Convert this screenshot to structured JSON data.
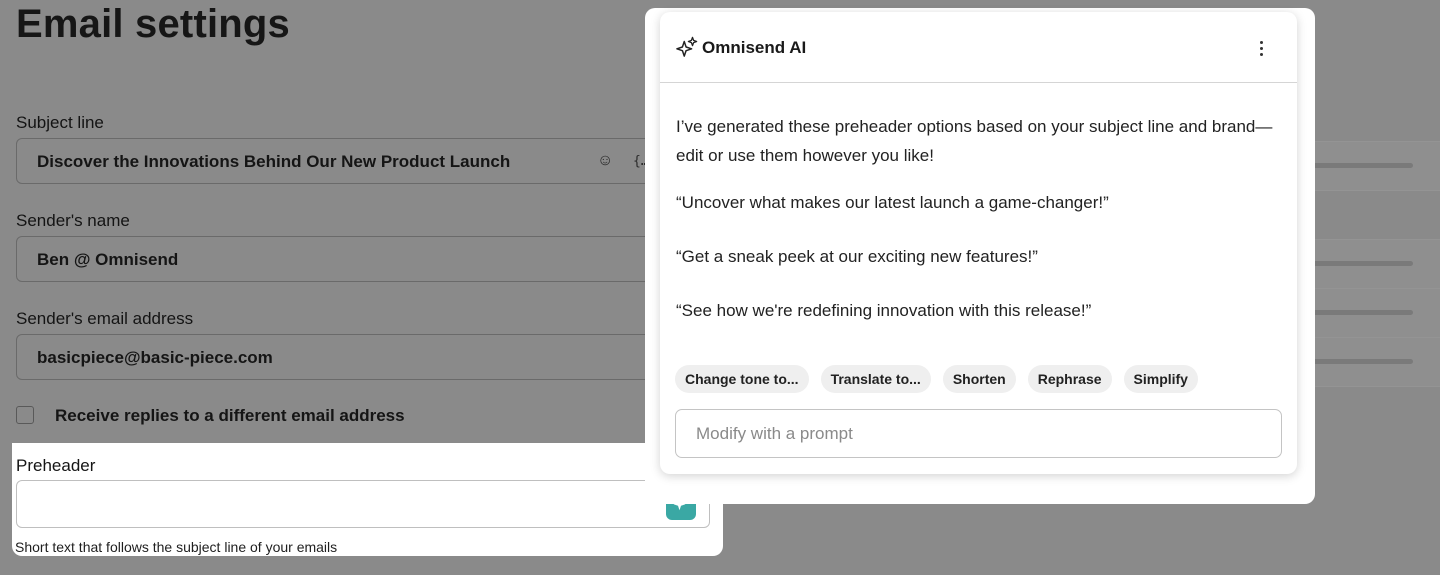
{
  "page": {
    "title": "Email settings"
  },
  "form": {
    "subject": {
      "label": "Subject line",
      "value": "Discover the Innovations Behind Our New Product Launch",
      "emoji_glyph": "☺",
      "merge_glyph": "{…}"
    },
    "sender_name": {
      "label": "Sender's name",
      "value": "Ben @ Omnisend"
    },
    "sender_email": {
      "label": "Sender's email address",
      "value": "basicpiece@basic-piece.com"
    },
    "reply_checkbox": {
      "label": "Receive replies to a different email address",
      "checked": false
    },
    "preheader": {
      "label": "Preheader",
      "value": "",
      "helper": "Short text that follows the subject line of your emails"
    }
  },
  "ai_panel": {
    "title": "Omnisend AI",
    "intro": "I’ve generated these preheader options based on your subject line and brand—edit or use them however you like!",
    "suggestions": [
      "“Uncover what makes our latest launch a game-changer!”",
      "“Get a sneak peek at our exciting new features!”",
      "“See how we're redefining innovation with this release!”"
    ],
    "chips": [
      "Change tone to...",
      "Translate to...",
      "Shorten",
      "Rephrase",
      "Simplify"
    ],
    "prompt_placeholder": "Modify with a prompt"
  },
  "colors": {
    "accent_teal": "#3aa8a4",
    "overlay": "#8a8a8a"
  },
  "icons": {
    "panel": "sparkle-outline-icon",
    "menu": "kebab-icon",
    "ai_button": "sparkle-icon",
    "subject_emoji": "emoji-icon",
    "subject_merge": "merge-tag-icon"
  }
}
